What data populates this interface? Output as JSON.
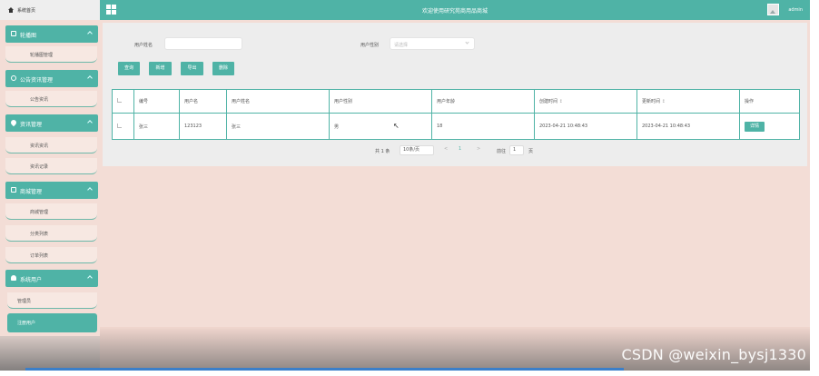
{
  "header": {
    "title": "欢迎使用研究苑商用品商城",
    "user": "admin"
  },
  "sidebar": {
    "home": "系统首页",
    "groups": [
      {
        "label": "轮播图",
        "items": [
          "轮播图管理"
        ]
      },
      {
        "label": "公告资讯管理",
        "items": [
          "公告资讯"
        ]
      },
      {
        "label": "资讯管理",
        "items": [
          "资讯资讯",
          "资讯记录"
        ]
      },
      {
        "label": "商城管理",
        "items": [
          "商城管理",
          "分类列表",
          "订单列表"
        ]
      },
      {
        "label": "系统用户",
        "items": [
          "管理员",
          "注册用户"
        ]
      }
    ]
  },
  "search": {
    "name_label": "用户姓名",
    "name_placeholder": "",
    "gender_label": "用户性别",
    "gender_placeholder": "请选择"
  },
  "buttons": {
    "query": "查询",
    "add": "新增",
    "export": "导出",
    "delete": "删除"
  },
  "table": {
    "headers": [
      "",
      "编号",
      "用户名",
      "用户姓名",
      "用户性别",
      "用户年龄",
      "创建时间",
      "更新时间",
      "操作"
    ],
    "rows": [
      [
        "",
        "张三",
        "123123",
        "张三",
        "男",
        "18",
        "2023-04-21 10:48:43",
        "2023-04-21 10:48:43"
      ]
    ],
    "detail_label": "详情"
  },
  "pager": {
    "total": "共 1 条",
    "page_size": "10条/页",
    "prev": "<",
    "current": "1",
    "next": ">",
    "goto_label": "前往",
    "goto_value": "1",
    "page_unit": "页"
  },
  "watermark": "CSDN @weixin_bysj1330"
}
